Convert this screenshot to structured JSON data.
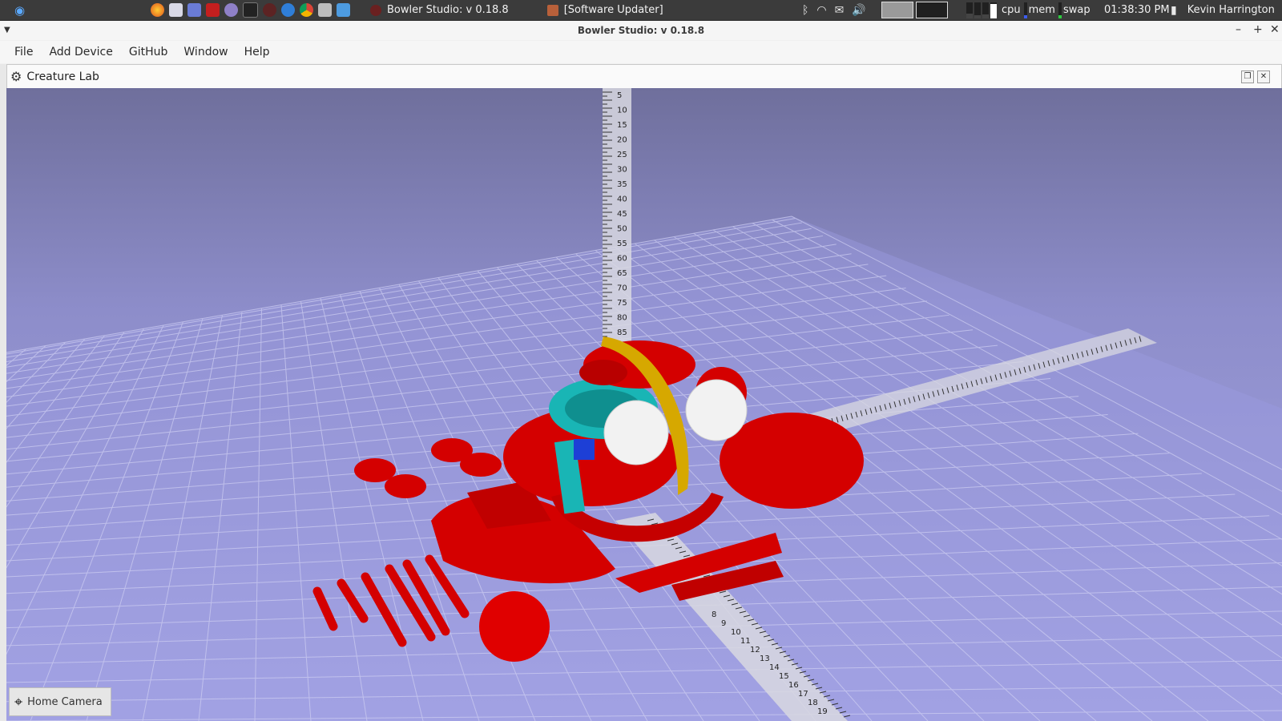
{
  "taskbar": {
    "tasks": [
      {
        "label": "Bowler Studio: v 0.18.8"
      },
      {
        "label": "[Software Updater]"
      }
    ],
    "system_monitor": {
      "cpu": "cpu",
      "mem": "mem",
      "swap": "swap"
    },
    "clock": "01:38:30 PM",
    "user": "Kevin Harrington"
  },
  "window": {
    "title": "Bowler Studio: v 0.18.8",
    "minimize": "–",
    "maximize": "+",
    "close": "✕"
  },
  "menu": {
    "items": [
      "File",
      "Add Device",
      "GitHub",
      "Window",
      "Help"
    ]
  },
  "dock": {
    "title": "Creature Lab",
    "restore": "❐",
    "close": "✕"
  },
  "viewport": {
    "home_camera_label": "Home Camera",
    "ruler_y_labels": [
      "5",
      "10",
      "15",
      "20",
      "25",
      "30",
      "35",
      "40",
      "45",
      "50",
      "55",
      "60",
      "65",
      "70",
      "75",
      "80",
      "85"
    ],
    "ruler_front_labels": [
      "8",
      "9",
      "10",
      "11",
      "12",
      "13",
      "14",
      "15",
      "16",
      "17",
      "18",
      "19"
    ]
  },
  "colors": {
    "model_red": "#d40000",
    "model_cyan": "#19b5b5",
    "model_yellow": "#d6a800",
    "eyes": "#f2f2f2"
  }
}
